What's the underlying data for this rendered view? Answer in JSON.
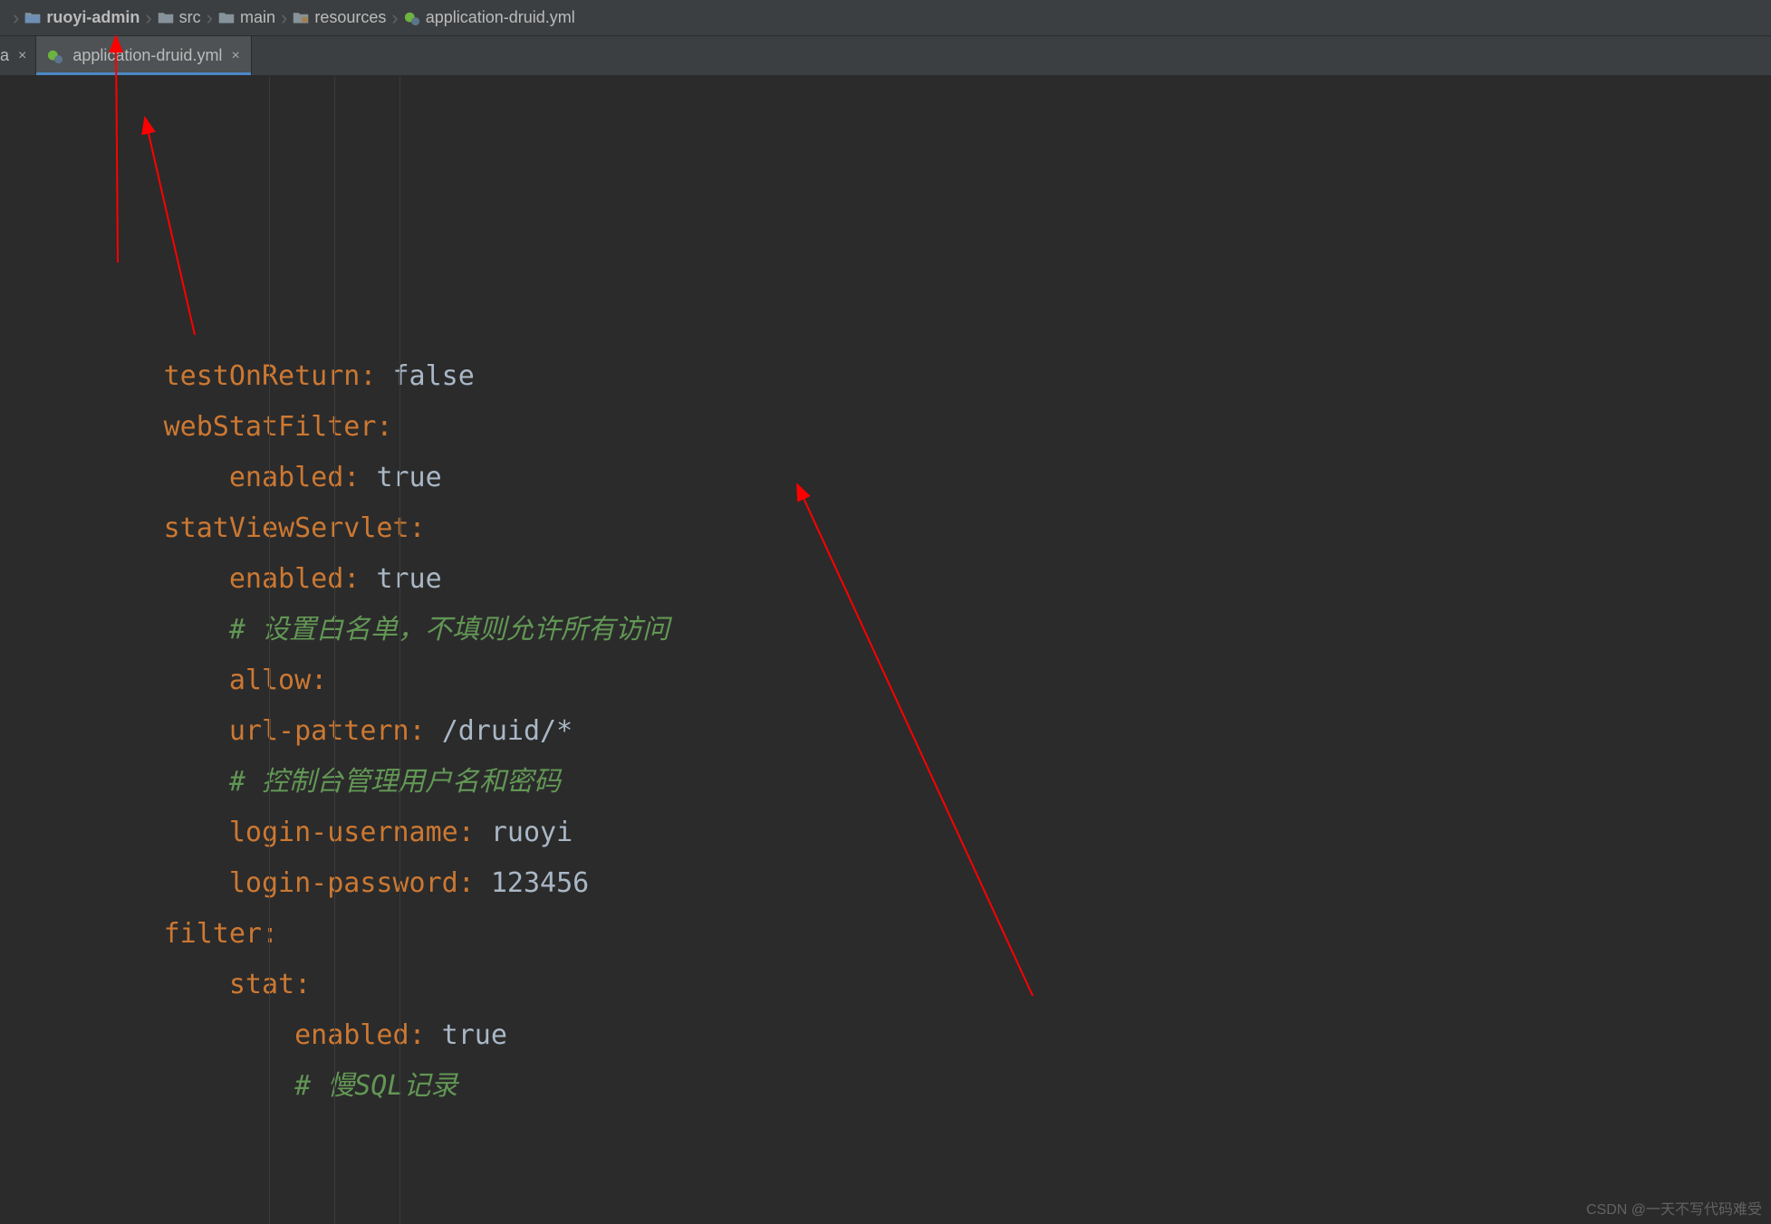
{
  "breadcrumb": [
    {
      "icon": "folder",
      "label": "ruoyi-admin",
      "bold": true
    },
    {
      "icon": "folder",
      "label": "src"
    },
    {
      "icon": "folder",
      "label": "main"
    },
    {
      "icon": "resources-folder",
      "label": "resources"
    },
    {
      "icon": "spring-file",
      "label": "application-druid.yml"
    }
  ],
  "tabs": {
    "inactive_suffix": "a",
    "active": {
      "label": "application-druid.yml"
    }
  },
  "code": {
    "l1": {
      "indent": 10,
      "key": "testOnReturn",
      "val": "false"
    },
    "l2": {
      "indent": 10,
      "key": "webStatFilter"
    },
    "l3": {
      "indent": 14,
      "key": "enabled",
      "val": "true"
    },
    "l4": {
      "indent": 10,
      "key": "statViewServlet"
    },
    "l5": {
      "indent": 14,
      "key": "enabled",
      "val": "true"
    },
    "l6": {
      "indent": 14,
      "comment": "# 设置白名单，不填则允许所有访问"
    },
    "l7": {
      "indent": 14,
      "key": "allow"
    },
    "l8": {
      "indent": 14,
      "key": "url-pattern",
      "val": "/druid/*"
    },
    "l9": {
      "indent": 14,
      "comment": "# 控制台管理用户名和密码"
    },
    "l10": {
      "indent": 14,
      "key": "login-username",
      "val": "ruoyi"
    },
    "l11": {
      "indent": 14,
      "key": "login-password",
      "val": "123456"
    },
    "l12": {
      "indent": 10,
      "key": "filter"
    },
    "l13": {
      "indent": 14,
      "key": "stat"
    },
    "l14": {
      "indent": 18,
      "key": "enabled",
      "val": "true"
    },
    "l15": {
      "indent": 18,
      "comment": "# 慢SQL记录"
    }
  },
  "watermark": "CSDN @一天不写代码难受",
  "close_glyph": "×"
}
